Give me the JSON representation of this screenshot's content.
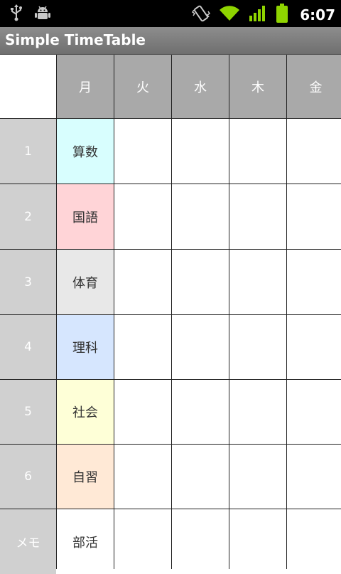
{
  "status_bar": {
    "time": "6:07",
    "icons": [
      "usb-icon",
      "android-debug-icon",
      "vibrate-icon",
      "wifi-icon",
      "signal-icon",
      "battery-icon"
    ]
  },
  "app": {
    "title": "Simple TimeTable"
  },
  "timetable": {
    "days": [
      "月",
      "火",
      "水",
      "木",
      "金"
    ],
    "periods": [
      "1",
      "2",
      "3",
      "4",
      "5",
      "6"
    ],
    "memo_label": "メモ",
    "monday": [
      {
        "subject": "算数",
        "color": "#d8fefe"
      },
      {
        "subject": "国語",
        "color": "#ffd4d7"
      },
      {
        "subject": "体育",
        "color": "#e8e8e8"
      },
      {
        "subject": "理科",
        "color": "#d6e6fe"
      },
      {
        "subject": "社会",
        "color": "#feffd7"
      },
      {
        "subject": "自習",
        "color": "#ffe9d6"
      }
    ],
    "memo_monday": "部活"
  }
}
